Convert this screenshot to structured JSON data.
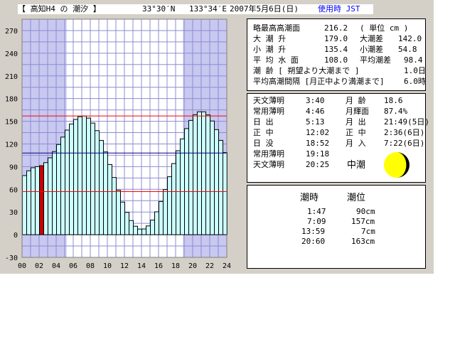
{
  "header": {
    "station": "【 高知H4 の 潮汐 】",
    "latitude": "33°30′N",
    "longitude": "133°34′E",
    "date": "2007年5月6日(日)",
    "timezone": "使用時 JST"
  },
  "info": [
    {
      "label": "略最高高潮面",
      "value": "216.2",
      "extra_label": "( 単位 cm )",
      "extra_value": ""
    },
    {
      "label": "大 潮 升",
      "value": "179.0",
      "extra_label": "大潮差",
      "extra_value": "142.0"
    },
    {
      "label": "小 潮 升",
      "value": "135.4",
      "extra_label": "小潮差",
      "extra_value": "54.8"
    },
    {
      "label": "平 均 水 面",
      "value": "108.0",
      "extra_label": "平均潮差",
      "extra_value": "98.4"
    },
    {
      "label": "潮 齢 [ 朔望より大潮まで ]",
      "value": "1.0日"
    },
    {
      "label": "平均高潮間隔 [月正中より満潮まで]",
      "value": "6.0時"
    }
  ],
  "sun_moon": {
    "rows": [
      {
        "label": "天文薄明",
        "value": "3:40",
        "label2": "月 齢",
        "value2": "18.6"
      },
      {
        "label": "常用薄明",
        "value": "4:46",
        "label2": "月輝面",
        "value2": "87.4%"
      },
      {
        "label": "日 出",
        "value": "5:13",
        "label2": "月 出",
        "value2": "21:49(5日)"
      },
      {
        "label": "正 中",
        "value": "12:02",
        "label2": "正 中",
        "value2": "2:36(6日)"
      },
      {
        "label": "日 没",
        "value": "18:52",
        "label2": "月 入",
        "value2": "7:22(6日)"
      },
      {
        "label": "常用薄明",
        "value": "19:18",
        "label2": "",
        "value2": ""
      },
      {
        "label": "天文薄明",
        "value": "20:25",
        "label2": "",
        "value2": ""
      }
    ],
    "tide_type": "中潮",
    "moon_icon": "moon-phase-icon",
    "moon_illumination": 0.874
  },
  "tides": {
    "header_time": "潮時",
    "header_level": "潮位",
    "rows": [
      {
        "time": "1:47",
        "level": "90cm"
      },
      {
        "time": "7:09",
        "level": "157cm"
      },
      {
        "time": "13:59",
        "level": "7cm"
      },
      {
        "time": "20:60",
        "level": "163cm"
      }
    ]
  },
  "colors": {
    "bar_fill": "#ccffff",
    "night": "#c8c8f0",
    "day": "#ffffff",
    "current_hour_bar": "#cc0000",
    "grid": "#8c8cd2",
    "mean_line": "#000080",
    "threshold_line": "#ff0000",
    "moon": "#ffff00"
  },
  "chart_data": {
    "type": "bar",
    "xlabel": "",
    "ylabel": "",
    "xlim": [
      0,
      24
    ],
    "ylim": [
      -30,
      285
    ],
    "x_ticks": [
      "00",
      "02",
      "04",
      "06",
      "08",
      "10",
      "12",
      "14",
      "16",
      "18",
      "20",
      "22",
      "24"
    ],
    "y_ticks": [
      "270",
      "240",
      "210",
      "180",
      "150",
      "120",
      "90",
      "60",
      "30",
      "0",
      "-30"
    ],
    "sunrise": 5.22,
    "sunset": 18.87,
    "current_time": 2.1,
    "mean_level": 108,
    "reference_lines": [
      157,
      57
    ],
    "tide_curve": {
      "extrema": [
        [
          -4.5,
          5
        ],
        [
          1.78,
          90
        ],
        [
          7.15,
          157
        ],
        [
          13.98,
          7
        ],
        [
          21.0,
          163
        ],
        [
          27.5,
          20
        ]
      ],
      "step_hours": 0.5
    }
  }
}
